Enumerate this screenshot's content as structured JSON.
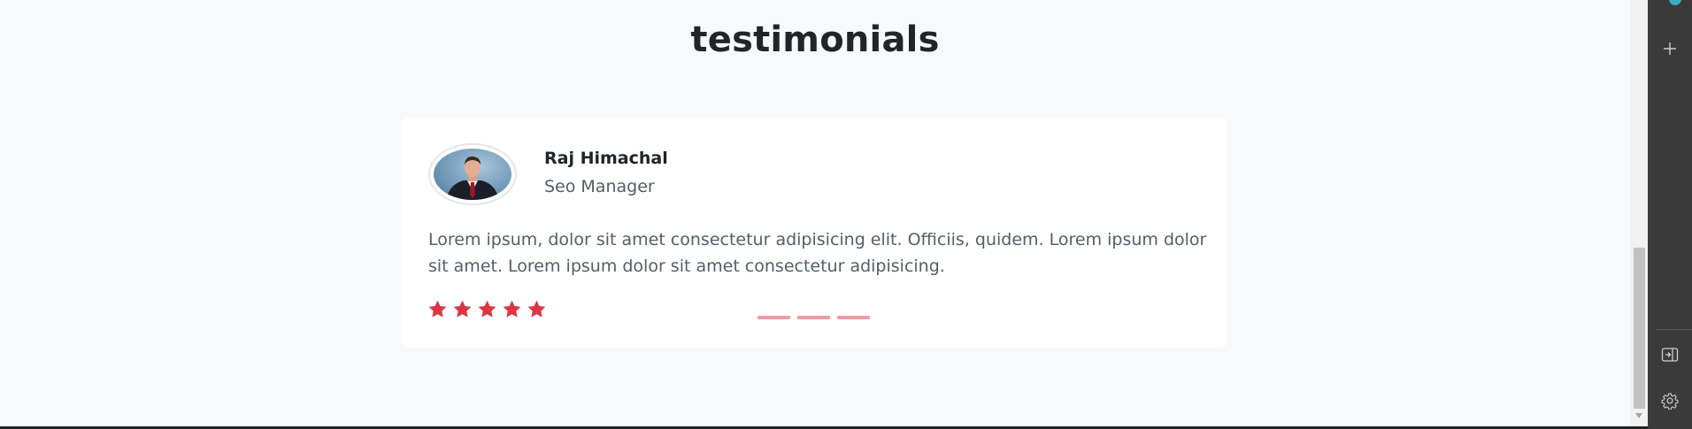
{
  "section": {
    "title": "testimonials"
  },
  "testimonial": {
    "name": "Raj Himachal",
    "role": "Seo Manager",
    "quote": "Lorem ipsum, dolor sit amet consectetur adipisicing elit. Officiis, quidem. Lorem ipsum dolor sit amet. Lorem ipsum dolor sit amet consectetur adipisicing.",
    "rating": 5,
    "rating_max": 5
  },
  "carousel": {
    "indicators": 3,
    "active_index": 0
  },
  "colors": {
    "star": "#dc3545",
    "indicator": "#f09aa3",
    "card_bg": "#ffffff",
    "page_bg": "#f8f9fa",
    "side_panel_bg": "#3a3a3a"
  },
  "side_panel": {
    "icons": [
      "app-icon",
      "plus-icon",
      "panel-toggle-icon",
      "settings-icon"
    ]
  }
}
